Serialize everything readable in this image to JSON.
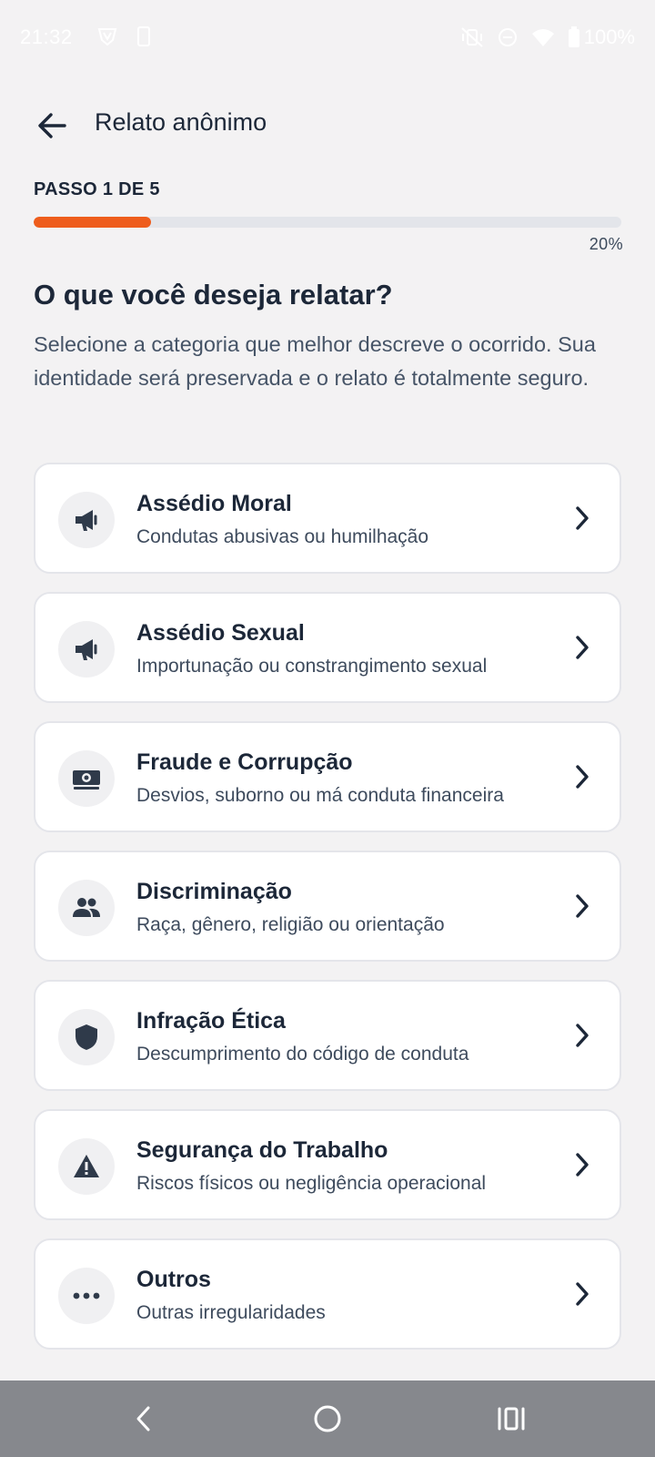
{
  "status_bar": {
    "time": "21:32",
    "battery": "100%",
    "icons": [
      "vpn-shield-icon",
      "phone-icon",
      "vibrate-off-icon",
      "dnd-icon",
      "wifi-icon",
      "battery-icon"
    ]
  },
  "app_bar": {
    "title": "Relato anônimo",
    "back_icon": "arrow-left-icon"
  },
  "progress": {
    "step_label": "PASSO 1 DE 5",
    "percent_label": "20%",
    "value": 0.2,
    "fill_color": "#ee5d1c"
  },
  "content": {
    "heading": "O que você deseja relatar?",
    "subtitle": "Selecione a categoria que melhor descreve o ocorrido. Sua identidade será preservada e o relato é totalmente seguro."
  },
  "categories": [
    {
      "title": "Assédio Moral",
      "subtitle": "Condutas abusivas ou humilhação",
      "icon": "megaphone-icon"
    },
    {
      "title": "Assédio Sexual",
      "subtitle": "Importunação ou constrangimento sexual",
      "icon": "megaphone-icon"
    },
    {
      "title": "Fraude e Corrupção",
      "subtitle": "Desvios, suborno ou má conduta financeira",
      "icon": "money-icon"
    },
    {
      "title": "Discriminação",
      "subtitle": "Raça, gênero, religião ou orientação",
      "icon": "people-icon"
    },
    {
      "title": "Infração Ética",
      "subtitle": "Descumprimento do código de conduta",
      "icon": "shield-icon"
    },
    {
      "title": "Segurança do Trabalho",
      "subtitle": "Riscos físicos ou negligência operacional",
      "icon": "warning-icon"
    },
    {
      "title": "Outros",
      "subtitle": "Outras irregularidades",
      "icon": "more-horizontal-icon"
    }
  ],
  "nav_bar": {
    "buttons": [
      "nav-back-icon",
      "nav-home-icon",
      "nav-recents-icon"
    ]
  }
}
